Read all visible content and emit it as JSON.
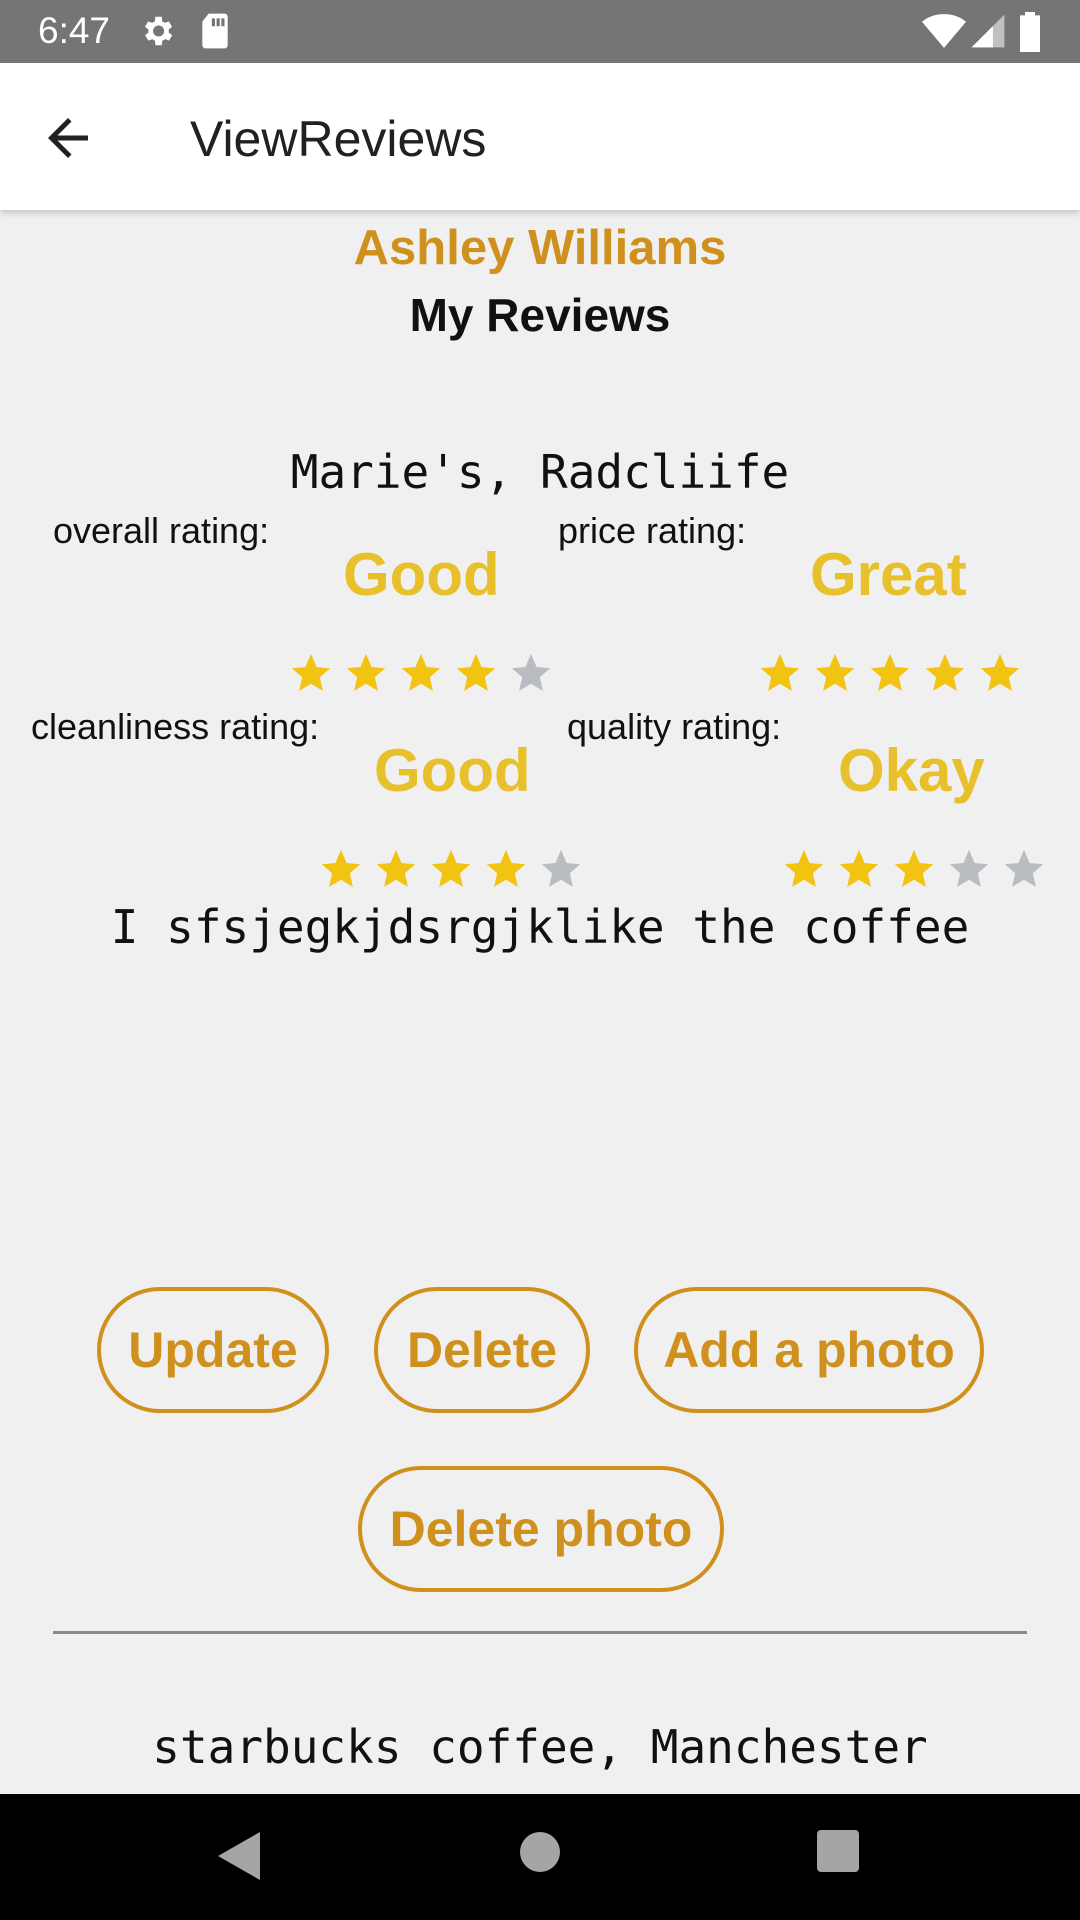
{
  "status_bar": {
    "time": "6:47",
    "icons": [
      "gear-icon",
      "sd-card-icon",
      "wifi-icon",
      "signal-icon",
      "battery-icon"
    ]
  },
  "app_bar": {
    "title": "ViewReviews",
    "back_icon": "arrow-back-icon"
  },
  "profile": {
    "name": "Ashley Williams",
    "section_title": "My Reviews"
  },
  "reviews": [
    {
      "place": "Marie's, Radcliife",
      "ratings": {
        "overall": {
          "label": "overall rating:",
          "word": "Good",
          "stars": 4,
          "max": 5
        },
        "price": {
          "label": "price rating:",
          "word": "Great",
          "stars": 5,
          "max": 5
        },
        "cleanliness": {
          "label": "cleanliness rating:",
          "word": "Good",
          "stars": 4,
          "max": 5
        },
        "quality": {
          "label": "quality rating:",
          "word": "Okay",
          "stars": 3,
          "max": 5
        }
      },
      "comment": "I sfsjegkjdsrgjklike the coffee",
      "buttons": {
        "update": "Update",
        "delete": "Delete",
        "add_photo": "Add a photo",
        "delete_photo": "Delete photo"
      }
    },
    {
      "place": "starbucks coffee, Manchester"
    }
  ],
  "colors": {
    "accent": "#cf901e",
    "rating_word": "#e8c02b",
    "star_on": "#f2c311",
    "star_off": "#b9bdc2",
    "status_bar": "#757575"
  },
  "nav_bar": {
    "icons": [
      "back-triangle-icon",
      "home-circle-icon",
      "recents-square-icon"
    ]
  }
}
